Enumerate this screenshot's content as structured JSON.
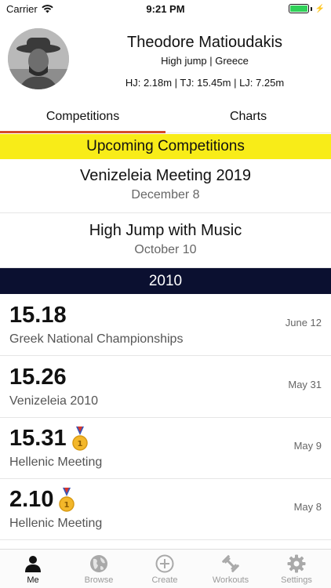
{
  "status_bar": {
    "carrier": "Carrier",
    "time": "9:21 PM"
  },
  "profile": {
    "name": "Theodore Matioudakis",
    "event_country": "High jump | Greece",
    "personal_bests": "HJ: 2.18m | TJ: 15.45m | LJ: 7.25m"
  },
  "tabs": [
    {
      "label": "Competitions",
      "active": true
    },
    {
      "label": "Charts",
      "active": false
    }
  ],
  "upcoming": {
    "header": "Upcoming Competitions",
    "items": [
      {
        "title": "Venizeleia Meeting 2019",
        "date": "December 8"
      },
      {
        "title": "High Jump with Music",
        "date": "October 10"
      }
    ]
  },
  "year_header": "2010",
  "results": [
    {
      "mark": "15.18",
      "meeting": "Greek National Championships",
      "date": "June 12",
      "medal": false
    },
    {
      "mark": "15.26",
      "meeting": "Venizeleia 2010",
      "date": "May 31",
      "medal": false
    },
    {
      "mark": "15.31",
      "meeting": "Hellenic Meeting",
      "date": "May 9",
      "medal": true
    },
    {
      "mark": "2.10",
      "meeting": "Hellenic Meeting",
      "date": "May 8",
      "medal": true
    }
  ],
  "tab_bar": [
    {
      "label": "Me",
      "icon": "person-icon",
      "active": true
    },
    {
      "label": "Browse",
      "icon": "globe-icon",
      "active": false
    },
    {
      "label": "Create",
      "icon": "plus-circle-icon",
      "active": false
    },
    {
      "label": "Workouts",
      "icon": "dumbbell-icon",
      "active": false
    },
    {
      "label": "Settings",
      "icon": "gear-icon",
      "active": false
    }
  ],
  "colors": {
    "upcoming_header_bg": "#f8ec18",
    "year_header_bg": "#0b1030",
    "active_tab_underline": "#d44a2c",
    "battery": "#2fd158"
  }
}
